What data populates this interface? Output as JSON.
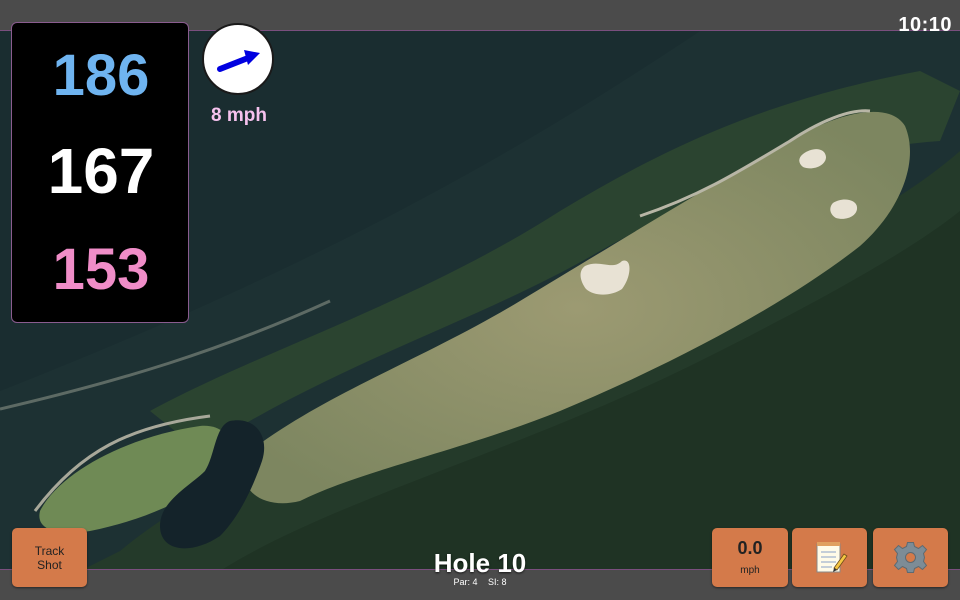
{
  "status": {
    "time": "10:10"
  },
  "distances": {
    "back": "186",
    "middle": "167",
    "front": "153"
  },
  "wind": {
    "speed_label": "8 mph",
    "direction_icon": "wind-arrow-icon"
  },
  "buttons": {
    "track_shot_line1": "Track",
    "track_shot_line2": "Shot",
    "speed_value": "0.0",
    "speed_unit": "mph",
    "notes_icon": "notepad-icon",
    "settings_icon": "gear-icon"
  },
  "hole": {
    "title": "Hole 10",
    "par": "Par: 4",
    "si": "SI: 8"
  },
  "colors": {
    "back_distance": "#6fb4f0",
    "middle_distance": "#ffffff",
    "front_distance": "#f08dc8",
    "button": "#d47a4a",
    "wind_label": "#f6c2ee"
  }
}
